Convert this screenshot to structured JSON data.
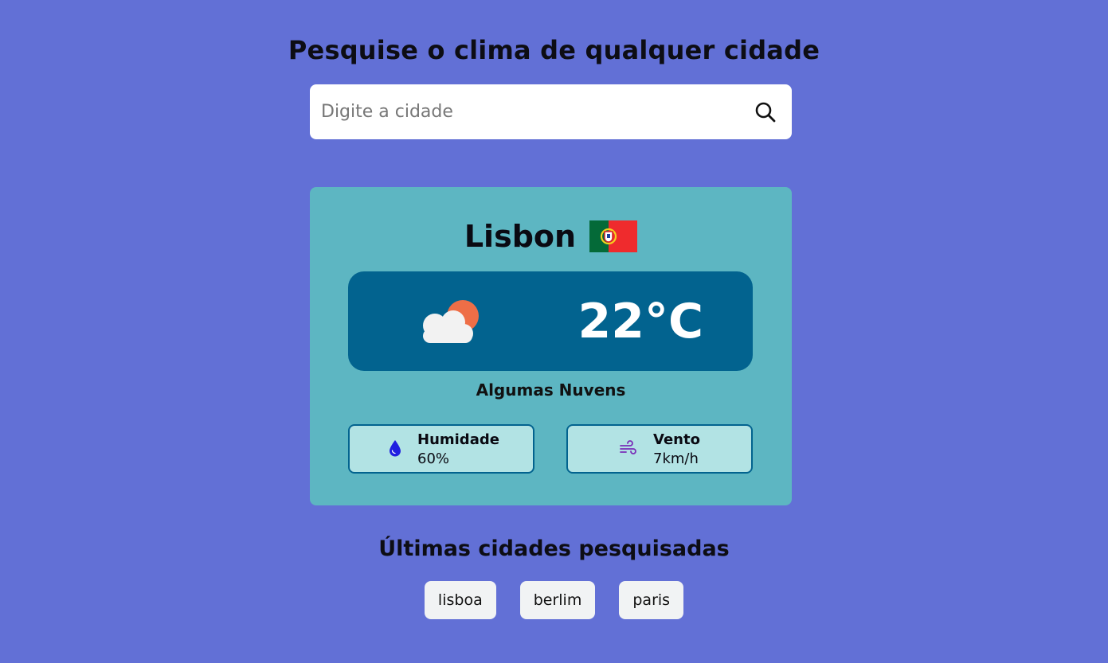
{
  "header": {
    "title": "Pesquise o clima de qualquer cidade"
  },
  "search": {
    "placeholder": "Digite a cidade",
    "value": "",
    "button_icon": "search-icon"
  },
  "weather": {
    "city": "Lisbon",
    "flag_icon": "portugal-flag-icon",
    "condition_icon": "partly-cloudy-icon",
    "temperature": "22°C",
    "description": "Algumas Nuvens",
    "humidity": {
      "label": "Humidade",
      "value": "60%",
      "icon": "water-drop-icon"
    },
    "wind": {
      "label": "Vento",
      "value": "7km/h",
      "icon": "wind-icon"
    }
  },
  "history": {
    "title": "Últimas cidades pesquisadas",
    "cities": [
      "lisboa",
      "berlim",
      "paris"
    ]
  },
  "colors": {
    "background": "#6270d6",
    "card": "#5db6c2",
    "temp_panel": "#02638f",
    "stat_box": "#b2e3e4",
    "chip": "#f1f3f4",
    "humidity_icon": "#1f1fe0",
    "wind_icon": "#7a2fb8"
  }
}
